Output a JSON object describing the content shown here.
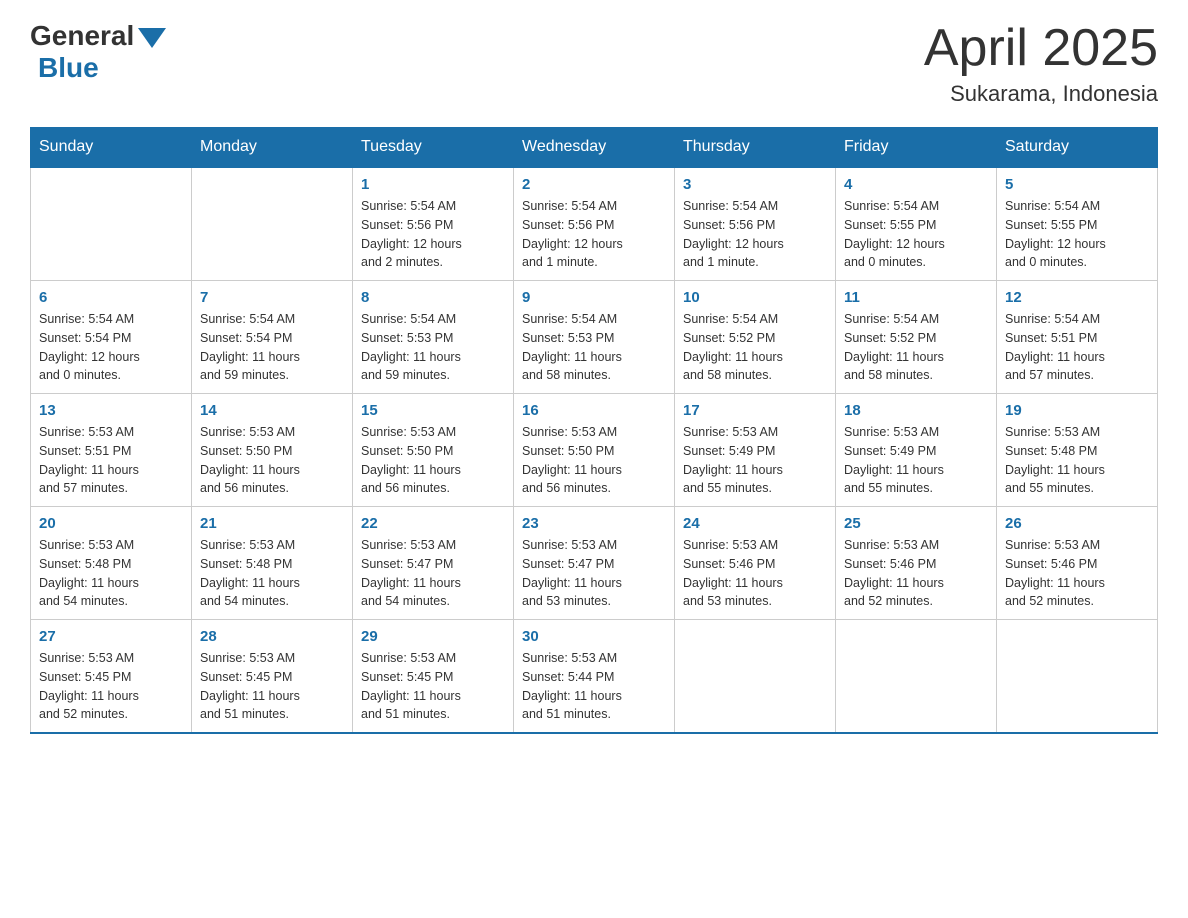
{
  "header": {
    "logo": {
      "general_text": "General",
      "blue_text": "Blue"
    },
    "title": "April 2025",
    "subtitle": "Sukarama, Indonesia"
  },
  "days_of_week": [
    "Sunday",
    "Monday",
    "Tuesday",
    "Wednesday",
    "Thursday",
    "Friday",
    "Saturday"
  ],
  "weeks": [
    [
      {
        "day": "",
        "info": ""
      },
      {
        "day": "",
        "info": ""
      },
      {
        "day": "1",
        "info": "Sunrise: 5:54 AM\nSunset: 5:56 PM\nDaylight: 12 hours\nand 2 minutes."
      },
      {
        "day": "2",
        "info": "Sunrise: 5:54 AM\nSunset: 5:56 PM\nDaylight: 12 hours\nand 1 minute."
      },
      {
        "day": "3",
        "info": "Sunrise: 5:54 AM\nSunset: 5:56 PM\nDaylight: 12 hours\nand 1 minute."
      },
      {
        "day": "4",
        "info": "Sunrise: 5:54 AM\nSunset: 5:55 PM\nDaylight: 12 hours\nand 0 minutes."
      },
      {
        "day": "5",
        "info": "Sunrise: 5:54 AM\nSunset: 5:55 PM\nDaylight: 12 hours\nand 0 minutes."
      }
    ],
    [
      {
        "day": "6",
        "info": "Sunrise: 5:54 AM\nSunset: 5:54 PM\nDaylight: 12 hours\nand 0 minutes."
      },
      {
        "day": "7",
        "info": "Sunrise: 5:54 AM\nSunset: 5:54 PM\nDaylight: 11 hours\nand 59 minutes."
      },
      {
        "day": "8",
        "info": "Sunrise: 5:54 AM\nSunset: 5:53 PM\nDaylight: 11 hours\nand 59 minutes."
      },
      {
        "day": "9",
        "info": "Sunrise: 5:54 AM\nSunset: 5:53 PM\nDaylight: 11 hours\nand 58 minutes."
      },
      {
        "day": "10",
        "info": "Sunrise: 5:54 AM\nSunset: 5:52 PM\nDaylight: 11 hours\nand 58 minutes."
      },
      {
        "day": "11",
        "info": "Sunrise: 5:54 AM\nSunset: 5:52 PM\nDaylight: 11 hours\nand 58 minutes."
      },
      {
        "day": "12",
        "info": "Sunrise: 5:54 AM\nSunset: 5:51 PM\nDaylight: 11 hours\nand 57 minutes."
      }
    ],
    [
      {
        "day": "13",
        "info": "Sunrise: 5:53 AM\nSunset: 5:51 PM\nDaylight: 11 hours\nand 57 minutes."
      },
      {
        "day": "14",
        "info": "Sunrise: 5:53 AM\nSunset: 5:50 PM\nDaylight: 11 hours\nand 56 minutes."
      },
      {
        "day": "15",
        "info": "Sunrise: 5:53 AM\nSunset: 5:50 PM\nDaylight: 11 hours\nand 56 minutes."
      },
      {
        "day": "16",
        "info": "Sunrise: 5:53 AM\nSunset: 5:50 PM\nDaylight: 11 hours\nand 56 minutes."
      },
      {
        "day": "17",
        "info": "Sunrise: 5:53 AM\nSunset: 5:49 PM\nDaylight: 11 hours\nand 55 minutes."
      },
      {
        "day": "18",
        "info": "Sunrise: 5:53 AM\nSunset: 5:49 PM\nDaylight: 11 hours\nand 55 minutes."
      },
      {
        "day": "19",
        "info": "Sunrise: 5:53 AM\nSunset: 5:48 PM\nDaylight: 11 hours\nand 55 minutes."
      }
    ],
    [
      {
        "day": "20",
        "info": "Sunrise: 5:53 AM\nSunset: 5:48 PM\nDaylight: 11 hours\nand 54 minutes."
      },
      {
        "day": "21",
        "info": "Sunrise: 5:53 AM\nSunset: 5:48 PM\nDaylight: 11 hours\nand 54 minutes."
      },
      {
        "day": "22",
        "info": "Sunrise: 5:53 AM\nSunset: 5:47 PM\nDaylight: 11 hours\nand 54 minutes."
      },
      {
        "day": "23",
        "info": "Sunrise: 5:53 AM\nSunset: 5:47 PM\nDaylight: 11 hours\nand 53 minutes."
      },
      {
        "day": "24",
        "info": "Sunrise: 5:53 AM\nSunset: 5:46 PM\nDaylight: 11 hours\nand 53 minutes."
      },
      {
        "day": "25",
        "info": "Sunrise: 5:53 AM\nSunset: 5:46 PM\nDaylight: 11 hours\nand 52 minutes."
      },
      {
        "day": "26",
        "info": "Sunrise: 5:53 AM\nSunset: 5:46 PM\nDaylight: 11 hours\nand 52 minutes."
      }
    ],
    [
      {
        "day": "27",
        "info": "Sunrise: 5:53 AM\nSunset: 5:45 PM\nDaylight: 11 hours\nand 52 minutes."
      },
      {
        "day": "28",
        "info": "Sunrise: 5:53 AM\nSunset: 5:45 PM\nDaylight: 11 hours\nand 51 minutes."
      },
      {
        "day": "29",
        "info": "Sunrise: 5:53 AM\nSunset: 5:45 PM\nDaylight: 11 hours\nand 51 minutes."
      },
      {
        "day": "30",
        "info": "Sunrise: 5:53 AM\nSunset: 5:44 PM\nDaylight: 11 hours\nand 51 minutes."
      },
      {
        "day": "",
        "info": ""
      },
      {
        "day": "",
        "info": ""
      },
      {
        "day": "",
        "info": ""
      }
    ]
  ]
}
